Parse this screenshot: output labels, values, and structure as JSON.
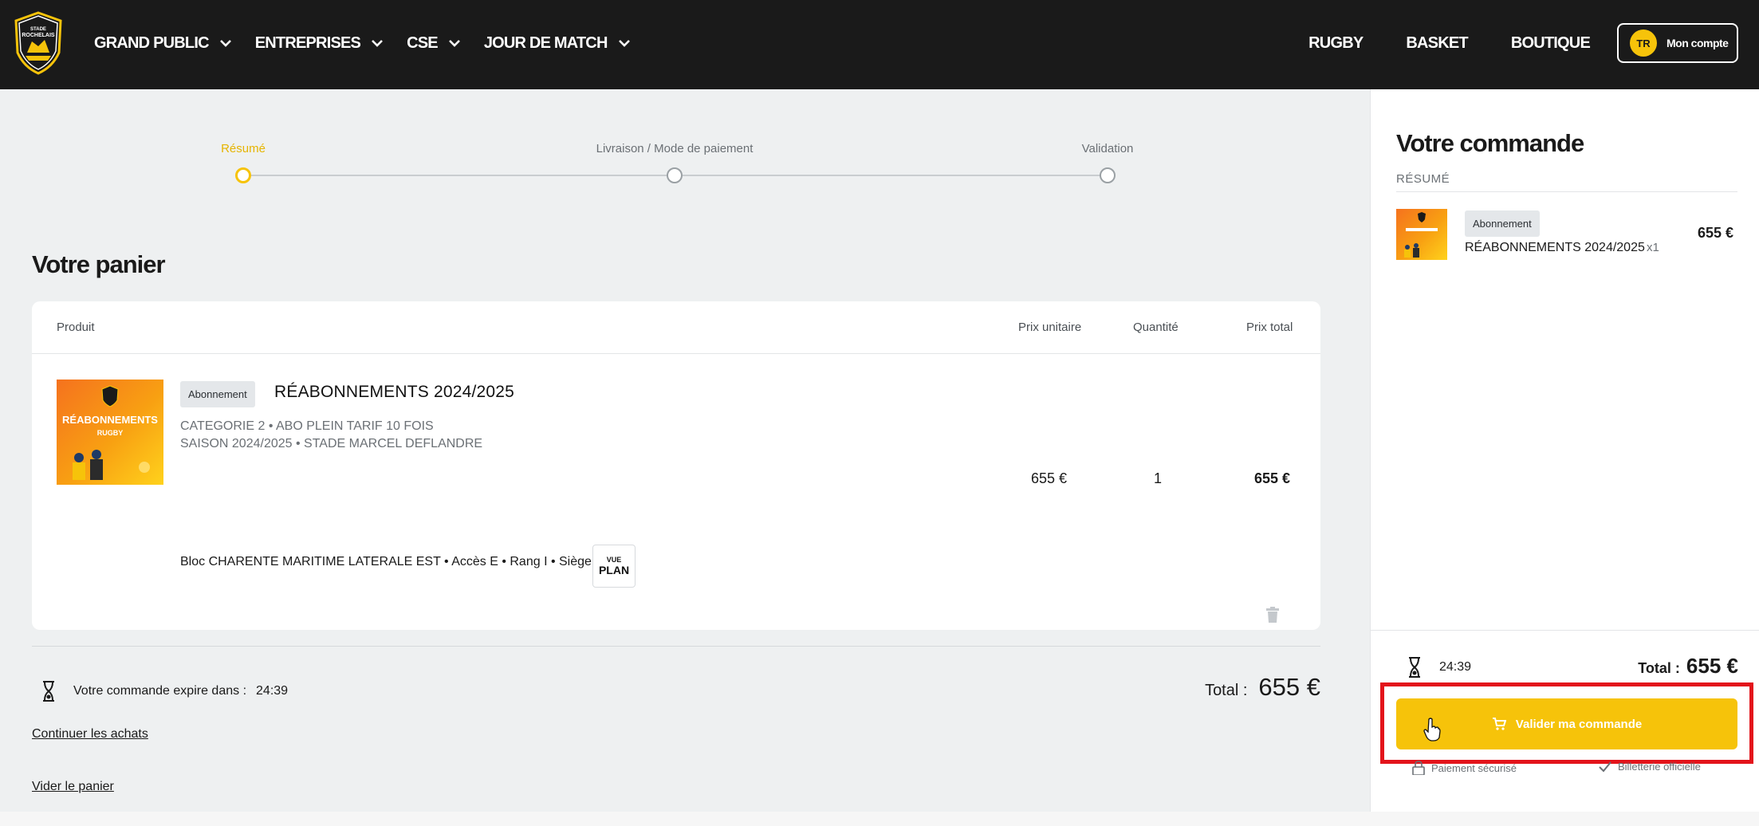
{
  "header": {
    "logo_text": "STADE ROCHELAIS",
    "nav_left": [
      {
        "label": "GRAND PUBLIC"
      },
      {
        "label": "ENTREPRISES"
      },
      {
        "label": "CSE"
      },
      {
        "label": "JOUR DE MATCH"
      }
    ],
    "nav_right": [
      {
        "label": "RUGBY"
      },
      {
        "label": "BASKET"
      },
      {
        "label": "BOUTIQUE"
      }
    ],
    "account": {
      "initials": "TR",
      "label": "Mon compte"
    }
  },
  "stepper": {
    "steps": [
      {
        "label": "Résumé",
        "active": true
      },
      {
        "label": "Livraison / Mode de paiement",
        "active": false
      },
      {
        "label": "Validation",
        "active": false
      }
    ]
  },
  "cart": {
    "title": "Votre panier",
    "columns": {
      "product": "Produit",
      "unit_price": "Prix unitaire",
      "quantity": "Quantité",
      "total_price": "Prix total"
    },
    "item": {
      "badge": "Abonnement",
      "name": "RÉABONNEMENTS 2024/2025",
      "line1": "CATEGORIE 2 • ABO PLEIN TARIF 10 FOIS",
      "line2": "SAISON 2024/2025 • STADE MARCEL DEFLANDRE",
      "seat": "Bloc CHARENTE MARITIME LATERALE EST • Accès E • Rang I • Siège 190",
      "plan_top": "VUE",
      "plan_bottom": "PLAN",
      "unit_price": "655 €",
      "quantity": "1",
      "total_price": "655 €",
      "image_text_1": "RÉABONNEMENTS",
      "image_text_2": "RUGBY"
    },
    "expire_label": "Votre commande expire dans :",
    "expire_timer": "24:39",
    "total_label": "Total :",
    "total_value": "655 €",
    "continue_link": "Continuer les achats",
    "empty_link": "Vider le panier"
  },
  "sidebar": {
    "title": "Votre commande",
    "section": "RÉSUMÉ",
    "item": {
      "badge": "Abonnement",
      "name": "RÉABONNEMENTS 2024/2025",
      "qty": "x1",
      "price": "655 €"
    },
    "timer": "24:39",
    "total_label": "Total :",
    "total_value": "655 €",
    "validate_label": "Valider ma commande",
    "trust_secure": "Paiement sécurisé",
    "trust_official": "Billetterie officielle"
  },
  "colors": {
    "accent": "#f6c30a",
    "dark": "#1a1a1a",
    "highlight": "#e3141b"
  }
}
